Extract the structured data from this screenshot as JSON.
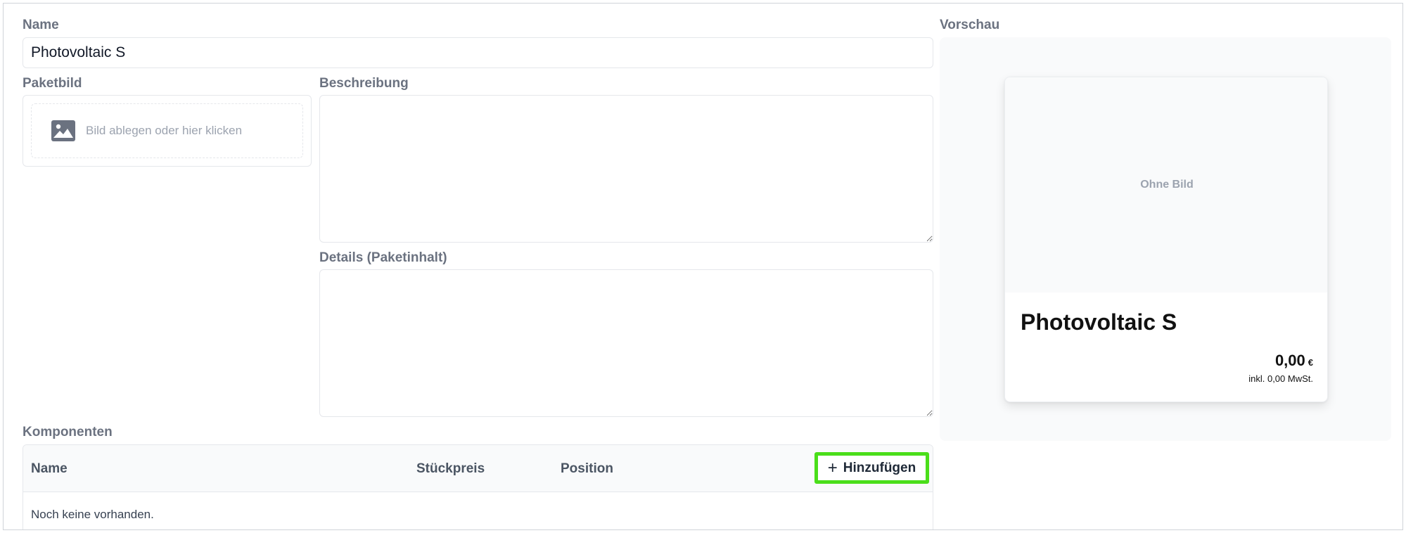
{
  "form": {
    "name_label": "Name",
    "name_value": "Photovoltaic S",
    "image_label": "Paketbild",
    "image_drop_text": "Bild ablegen oder hier klicken",
    "description_label": "Beschreibung",
    "description_value": "",
    "details_label": "Details (Paketinhalt)",
    "details_value": ""
  },
  "preview": {
    "label": "Vorschau",
    "no_image_text": "Ohne Bild",
    "title": "Photovoltaic S",
    "price": "0,00",
    "currency": "€",
    "tax_text": "inkl. 0,00 MwSt."
  },
  "components": {
    "label": "Komponenten",
    "columns": [
      "Name",
      "Stückpreis",
      "Position"
    ],
    "add_button_label": "Hinzufügen",
    "empty_text": "Noch keine vorhanden."
  },
  "colors": {
    "highlight": "#4ade1a",
    "label_gray": "#6b7280",
    "preview_background": "#f9fafb"
  },
  "icons": {
    "image_placeholder": "image-icon",
    "add": "plus-icon"
  }
}
